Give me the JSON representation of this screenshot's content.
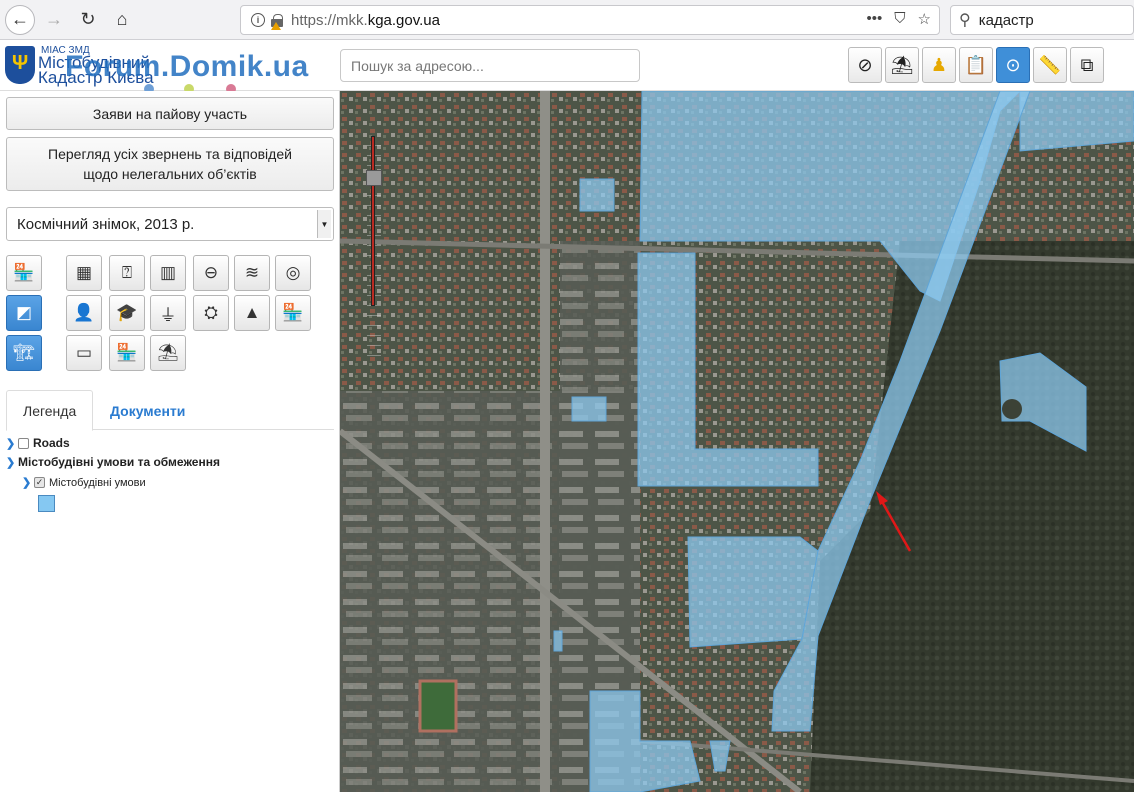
{
  "browser": {
    "url_protocol": "https://mkk.",
    "url_host": "kga.gov.ua",
    "search_value": "кадастр",
    "icons": [
      "back-icon",
      "forward-icon",
      "reload-icon",
      "home-icon",
      "info-icon",
      "lock-icon",
      "more-icon",
      "pocket-icon",
      "star-icon",
      "search-icon"
    ]
  },
  "header": {
    "logo_sub": "МІАС ЗМД",
    "logo_line1": "Містобудівний",
    "logo_line2": "Кадастр Києва",
    "watermark": "Forum.Domik.ua",
    "address_placeholder": "Пошук за адресою...",
    "dot_colors": [
      "#6e9fd6",
      "#c9d96a",
      "#d97a95"
    ],
    "tools": [
      "no-kiosk-icon",
      "kiosk-umbrella-icon",
      "street-view-person-icon",
      "clipboard-icon",
      "compass-icon",
      "ruler-icon",
      "area-measure-icon"
    ]
  },
  "sidebar": {
    "btn_share": "Заяви на пайову участь",
    "btn_illegal": "Перегляд усіх звернень та відповідей щодо нелегальних об’єктів",
    "layer_value": "Космічний знімок, 2013 р.",
    "icon_buttons": [
      {
        "name": "kiosk-icon",
        "glyph": "🏪"
      },
      {
        "name": "parcel-hatch-icon",
        "glyph": "▦"
      },
      {
        "name": "parcel-question-icon",
        "glyph": "⍰"
      },
      {
        "name": "hatch-area-icon",
        "glyph": "▥"
      },
      {
        "name": "restricted-zone-icon",
        "glyph": "⊖"
      },
      {
        "name": "stripes-zone-icon",
        "glyph": "≋"
      },
      {
        "name": "green-zone-icon",
        "glyph": "◎"
      },
      {
        "name": "map-layer-icon",
        "glyph": "◩"
      },
      {
        "name": "person-icon",
        "glyph": "👤"
      },
      {
        "name": "education-icon",
        "glyph": "🎓"
      },
      {
        "name": "monument-icon",
        "glyph": "⏚"
      },
      {
        "name": "police-badge-icon",
        "glyph": "⛭"
      },
      {
        "name": "road-icon",
        "glyph": "▲"
      },
      {
        "name": "shop-icon",
        "glyph": "🏪"
      },
      {
        "name": "construction-crane-icon",
        "glyph": "🏗"
      },
      {
        "name": "billboard-icon",
        "glyph": "▭"
      },
      {
        "name": "market-stall-icon",
        "glyph": "🏪"
      },
      {
        "name": "umbrella-stall-icon",
        "glyph": "⛱"
      }
    ],
    "tabs": {
      "legend": "Легенда",
      "documents": "Документи"
    },
    "tree": {
      "roads": "Roads",
      "group": "Містобудівні умови та обмеження",
      "child": "Містобудівні умови"
    },
    "legend_color": "#85c8f2"
  },
  "map": {
    "layer_fill": "#8ec9ef",
    "arrow_color": "#e01818"
  }
}
